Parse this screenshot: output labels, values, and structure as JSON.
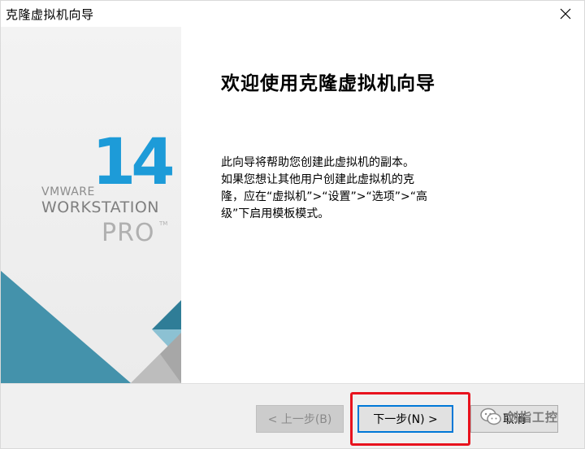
{
  "window": {
    "title": "克隆虚拟机向导"
  },
  "banner": {
    "logo_number": "14",
    "logo_vmware": "VMWARE",
    "logo_workstation": "WORKSTATION",
    "logo_pro": "PRO",
    "logo_tm": "TM"
  },
  "content": {
    "heading": "欢迎使用克隆虚拟机向导",
    "description_lines": [
      "此向导将帮助您创建此虚拟机的副本。",
      "如果您想让其他用户创建此虚拟机的克",
      "隆，应在“虚拟机”>“设置”>“选项”>“高",
      "级”下启用模板模式。"
    ]
  },
  "buttons": {
    "back_label": "< 上一步(B)",
    "next_label": "下一步(N) >",
    "cancel_label": "取消"
  },
  "watermark": {
    "text": "剑指工控"
  },
  "colors": {
    "accent_blue": "#1d9bd8",
    "focus_border": "#0078d7",
    "highlight_red": "#e8131e",
    "teal_dark": "#3e8aa3",
    "teal_light": "#6fb2c8"
  }
}
